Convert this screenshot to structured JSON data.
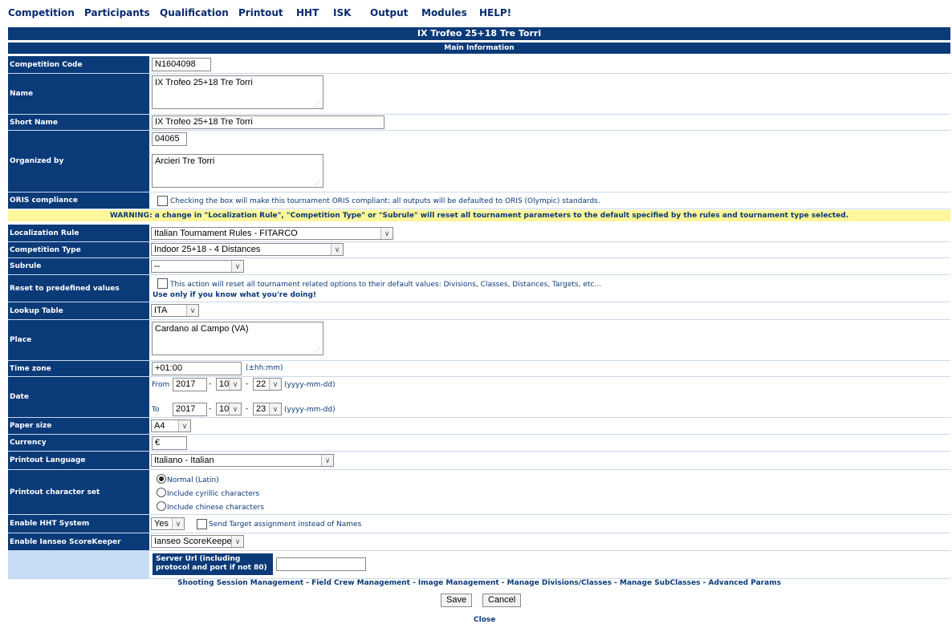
{
  "menu": [
    "Competition",
    "Participants",
    "Qualification",
    "Printout",
    "HHT",
    "ISK",
    "Output",
    "Modules",
    "HELP!"
  ],
  "title": "IX Trofeo 25+18 Tre Torri",
  "section": "Main Information",
  "fields": {
    "competition_code": {
      "label": "Competition Code",
      "value": "N1604098"
    },
    "name": {
      "label": "Name",
      "value": "IX Trofeo 25+18 Tre Torri"
    },
    "short_name": {
      "label": "Short Name",
      "value": "IX Trofeo 25+18 Tre Torri"
    },
    "organized_by": {
      "label": "Organized by",
      "code": "04065",
      "value": "Arcieri Tre Torri"
    },
    "oris": {
      "label": "ORIS compliance",
      "text": "Checking the box will make this tournament ORIS compliant: all outputs will be defaulted to ORIS (Olympic) standards."
    },
    "warning": "WARNING: a change in \"Localization Rule\", \"Competition Type\" or \"Subrule\" will reset all tournament parameters to the default specified by the rules and tournament type selected.",
    "localization_rule": {
      "label": "Localization Rule",
      "value": "Italian Tournament Rules - FITARCO"
    },
    "competition_type": {
      "label": "Competition Type",
      "value": "Indoor 25+18 - 4 Distances"
    },
    "subrule": {
      "label": "Subrule",
      "value": "--"
    },
    "reset": {
      "label": "Reset to predefined values",
      "text": "This action will reset all tournament related options to their default values: Divisions, Classes, Distances, Targets, etc...",
      "warn": "Use only if you know what you're doing!"
    },
    "lookup_table": {
      "label": "Lookup Table",
      "value": "ITA"
    },
    "place": {
      "label": "Place",
      "value": "Cardano al Campo (VA)"
    },
    "time_zone": {
      "label": "Time zone",
      "value": "+01:00",
      "hint": "(±hh:mm)"
    },
    "date": {
      "label": "Date",
      "from_label": "From",
      "to_label": "To",
      "from_year": "2017",
      "from_month": "10",
      "from_day": "22",
      "to_year": "2017",
      "to_month": "10",
      "to_day": "23",
      "sep": "-",
      "hint": "(yyyy-mm-dd)"
    },
    "paper_size": {
      "label": "Paper size",
      "value": "A4"
    },
    "currency": {
      "label": "Currency",
      "value": "€"
    },
    "printout_language": {
      "label": "Printout Language",
      "value": "Italiano - Italian"
    },
    "charset": {
      "label": "Printout character set",
      "options": [
        "Normal (Latin)",
        "Include cyrillic characters",
        "Include chinese characters"
      ]
    },
    "hht": {
      "label": "Enable HHT System",
      "value": "Yes",
      "check_text": "Send Target assignment instead of Names"
    },
    "scorekeeper": {
      "label": "Enable Ianseo ScoreKeeper",
      "value": "Ianseo ScoreKeeper"
    },
    "server_url": {
      "label": "Server Url (including protocol and port if not 80)",
      "value": ""
    }
  },
  "links": [
    "Shooting Session Management",
    "Field Crew Management",
    "Image Management",
    "Manage Divisions/Classes",
    "Manage SubClasses",
    "Advanced Params"
  ],
  "link_sep": " - ",
  "buttons": {
    "save": "Save",
    "cancel": "Cancel",
    "close": "Close"
  }
}
